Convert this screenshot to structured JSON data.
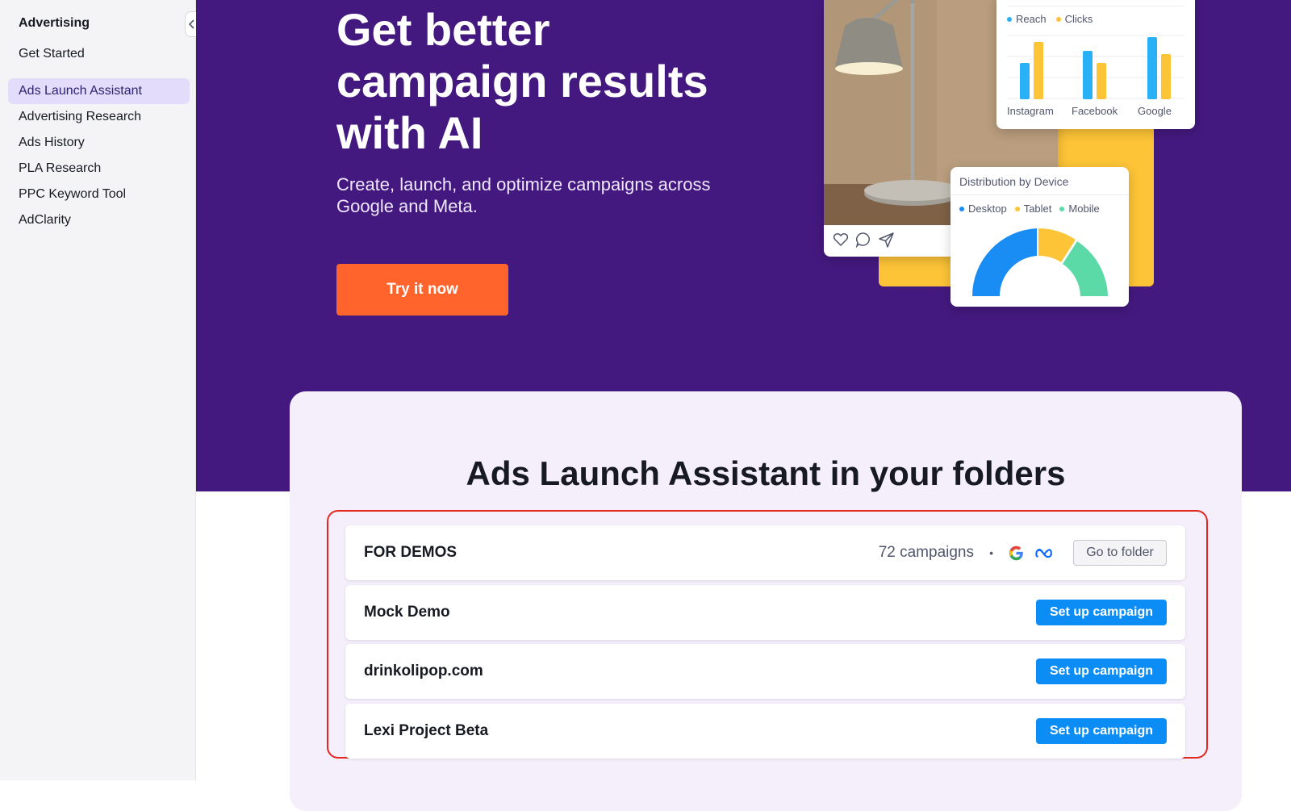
{
  "sidebar": {
    "title": "Advertising",
    "items": [
      {
        "label": "Get Started",
        "active": false
      },
      {
        "label": "Ads Launch Assistant",
        "active": true
      },
      {
        "label": "Advertising Research",
        "active": false
      },
      {
        "label": "Ads History",
        "active": false
      },
      {
        "label": "PLA Research",
        "active": false
      },
      {
        "label": "PPC Keyword Tool",
        "active": false
      },
      {
        "label": "AdClarity",
        "active": false
      }
    ]
  },
  "hero": {
    "title": "Get better campaign results with AI",
    "subtitle": "Create, launch, and optimize campaigns across Google and Meta.",
    "cta_label": "Try it now"
  },
  "illustration": {
    "bar_chart": {
      "legend": [
        "Reach",
        "Clicks"
      ],
      "categories": [
        "Instagram",
        "Facebook",
        "Google"
      ],
      "colors": {
        "Reach": "#2ab0f7",
        "Clicks": "#fdc437"
      }
    },
    "donut": {
      "title": "Distribution by Device",
      "legend": [
        "Desktop",
        "Tablet",
        "Mobile"
      ],
      "colors": {
        "Desktop": "#1a8df5",
        "Tablet": "#fdc437",
        "Mobile": "#5bd9a7"
      }
    },
    "photo_icons": [
      "heart-icon",
      "comment-icon",
      "send-icon"
    ]
  },
  "folders": {
    "title": "Ads Launch Assistant in your folders",
    "rows": [
      {
        "name": "FOR DEMOS",
        "count": "72 campaigns",
        "bullet": "•",
        "action": "Go to folder",
        "platforms": [
          "google-icon",
          "meta-icon"
        ]
      },
      {
        "name": "Mock Demo",
        "action": "Set up campaign"
      },
      {
        "name": "drinkolipop.com",
        "action": "Set up campaign"
      },
      {
        "name": "Lexi Project Beta",
        "action": "Set up campaign"
      }
    ]
  },
  "colors": {
    "hero_bg": "#44197f",
    "cta": "#ff642d",
    "primary_button": "#0c8df5",
    "highlight": "#e3271f",
    "active_nav": "#e3ddfb"
  }
}
